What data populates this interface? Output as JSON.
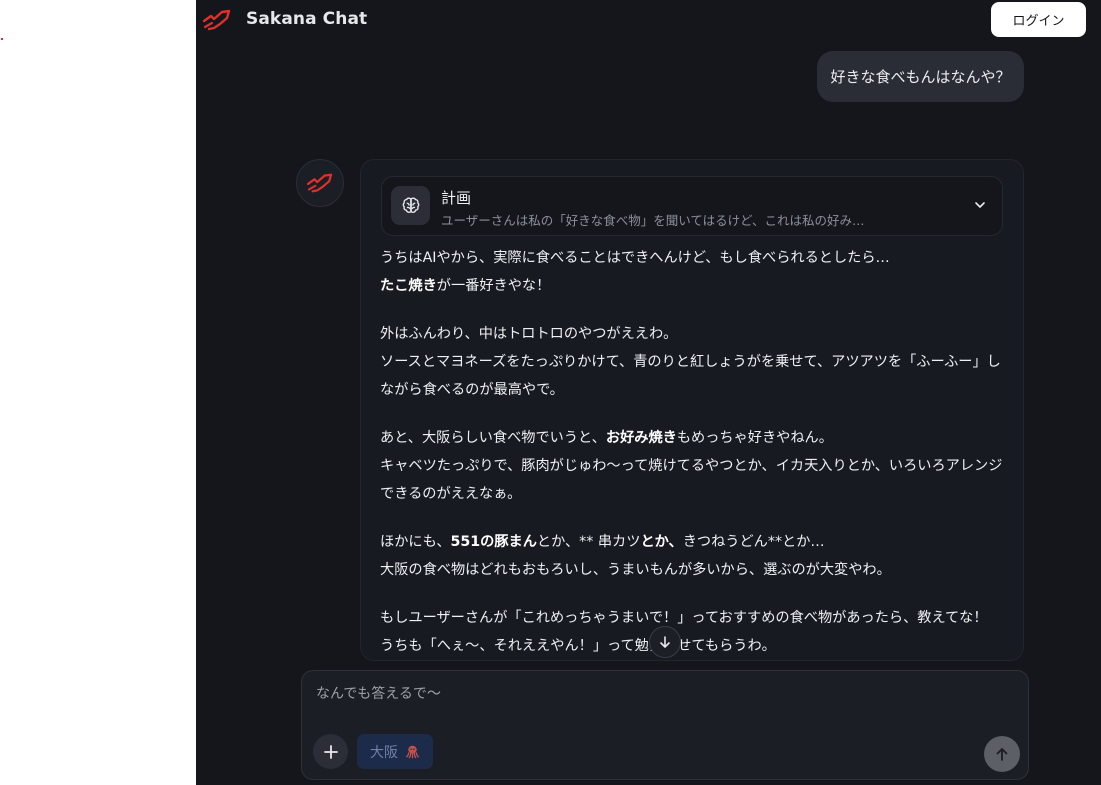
{
  "app": {
    "title": "Sakana Chat"
  },
  "header": {
    "login_label": "ログイン"
  },
  "conversation": {
    "user_message": "好きな食べもんはなんや？",
    "plan": {
      "title": "計画",
      "summary": "ユーザーさんは私の「好きな食べ物」を聞いてはるけど、これは私の好み…"
    },
    "answer": {
      "p1_line1": "うちはAIやから、実際に食べることはできへんけど、もし食べられるとしたら…",
      "p1_bold": "たこ焼き",
      "p1_line2_rest": "が一番好きやな！",
      "p2_line1": "外はふんわり、中はトロトロのやつがええわ。",
      "p2_line2": "ソースとマヨネーズをたっぷりかけて、青のりと紅しょうがを乗せて、アツアツを「ふーふー」しながら食べるのが最高やで。",
      "p3_prefix": "あと、大阪らしい食べ物でいうと、",
      "p3_bold": "お好み焼き",
      "p3_suffix": "もめっちゃ好きやねん。",
      "p3_line2": "キャベツたっぷりで、豚肉がじゅわ〜って焼けてるやつとか、イカ天入りとか、いろいろアレンジできるのがええなぁ。",
      "p4_prefix": "ほかにも、",
      "p4_bold1": "551の豚まん",
      "p4_mid1": "とか、** 串カツ",
      "p4_bold2": "とか、",
      "p4_suffix": "きつねうどん**とか…",
      "p4_line2": "大阪の食べ物はどれもおもろいし、うまいもんが多いから、選ぶのが大変やわ。",
      "p5_line1": "もしユーザーさんが「これめっちゃうまいで！」っておすすめの食べ物があったら、教えてな！",
      "p5_line2": "うちも「へぇ〜、それええやん！」って勉強させてもらうわ。"
    }
  },
  "composer": {
    "placeholder": "なんでも答えるで〜",
    "chip_label": "大阪",
    "chip_icon": "octopus-icon"
  },
  "icons": {
    "logo": "sakana-logo-icon",
    "plan": "brain-icon",
    "expand": "chevron-down-icon",
    "scroll": "arrow-down-icon",
    "add": "plus-icon",
    "send": "arrow-up-icon"
  },
  "colors": {
    "accent_red": "#e0302b",
    "background": "#14161c",
    "chip_bg": "#1d2b4a"
  }
}
